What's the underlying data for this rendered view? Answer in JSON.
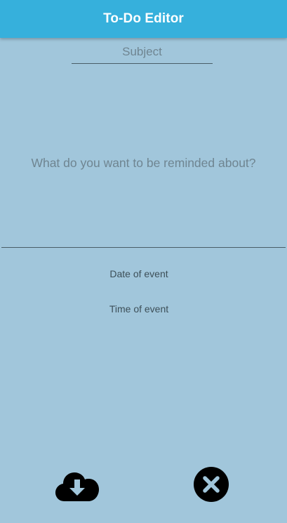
{
  "app_bar": {
    "title": "To-Do Editor",
    "background_color": "#36b0dc"
  },
  "form": {
    "subject_placeholder": "Subject",
    "body_placeholder": "What do you want to be reminded about?",
    "date_label": "Date of event",
    "time_label": "Time of event",
    "background_color": "#a1c6db"
  },
  "actions": {
    "save_icon": "cloud-download-icon",
    "cancel_icon": "close-circle-icon"
  }
}
